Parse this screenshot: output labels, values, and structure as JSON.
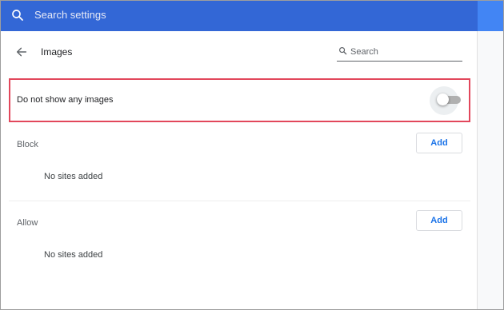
{
  "topbar": {
    "search_placeholder": "Search settings",
    "search_icon": "search-icon",
    "bg_color": "#3367d6"
  },
  "header": {
    "back_icon": "arrow-back-icon",
    "title": "Images",
    "search_placeholder": "Search",
    "search_icon": "search-icon"
  },
  "toggle_row": {
    "label": "Do not show any images",
    "enabled": false,
    "highlight_color": "#e2475b"
  },
  "sections": {
    "block": {
      "label": "Block",
      "add_label": "Add",
      "empty_text": "No sites added"
    },
    "allow": {
      "label": "Allow",
      "add_label": "Add",
      "empty_text": "No sites added"
    }
  },
  "colors": {
    "accent": "#1a73e8"
  }
}
